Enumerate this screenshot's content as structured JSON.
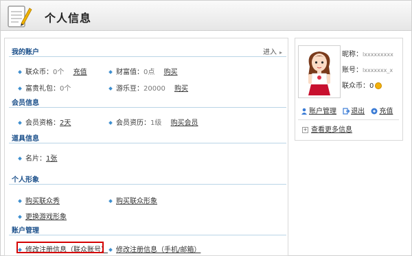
{
  "header": {
    "title": "个人信息"
  },
  "sections": {
    "account": {
      "title": "我的账户",
      "enter_label": "进入",
      "coins_label": "联众币：",
      "coins_value": "0个",
      "coins_action": "充值",
      "wealth_label": "财富值：",
      "wealth_value": "0点",
      "wealth_action": "购买",
      "gift_label": "富贵礼包：",
      "gift_value": "0个",
      "beans_label": "游乐豆：",
      "beans_value": "20000",
      "beans_action": "购买"
    },
    "member": {
      "title": "会员信息",
      "qual_label": "会员资格：",
      "qual_value": "2天",
      "level_label": "会员资历：",
      "level_value": "1级",
      "buy_label": "购买会员"
    },
    "items": {
      "title": "道具信息",
      "card_label": "名片：",
      "card_value": "1张"
    },
    "image": {
      "title": "个人形象",
      "link1": "购买联众秀",
      "link2": "购买联众形象",
      "link3": "更换游戏形象"
    },
    "manage": {
      "title": "账户管理",
      "link1": "修改注册信息（联众账号）",
      "link2": "修改注册信息（手机/邮箱）"
    }
  },
  "side": {
    "nickname_label": "昵称：",
    "nickname_value": "lxxxxxxxxx",
    "account_label": "账号：",
    "account_value": "lxxxxxxx_x",
    "coins_label": "联众币：",
    "coins_value": "0",
    "manage_label": "账户管理",
    "logout_label": "退出",
    "recharge_label": "充值",
    "more_label": "查看更多信息"
  },
  "colors": {
    "accent": "#1a4f8a",
    "highlight": "#d40000",
    "bullet": "#3e8fcf"
  }
}
